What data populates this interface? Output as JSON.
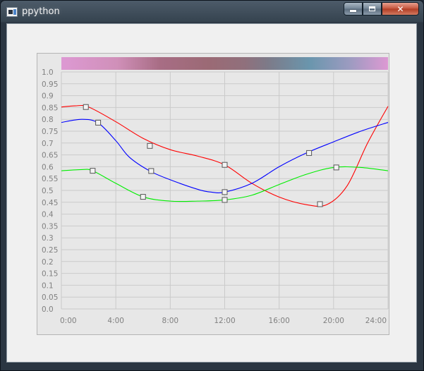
{
  "window": {
    "title": "ppython",
    "buttons": {
      "minimize": "minimize-icon",
      "maximize": "maximize-icon",
      "close": "close-icon"
    }
  },
  "chart_data": {
    "type": "line",
    "title": "",
    "xlabel": "",
    "ylabel": "",
    "x_ticks": [
      "0:00",
      "4:00",
      "8:00",
      "12:00",
      "16:00",
      "20:00",
      "24:00"
    ],
    "y_ticks": [
      "0.0",
      "0.05",
      "0.1",
      "0.15",
      "0.2",
      "0.25",
      "0.3",
      "0.35",
      "0.4",
      "0.45",
      "0.5",
      "0.55",
      "0.6",
      "0.65",
      "0.7",
      "0.75",
      "0.8",
      "0.85",
      "0.9",
      "0.95",
      "1.0"
    ],
    "xlim": [
      0,
      24
    ],
    "ylim": [
      0,
      1
    ],
    "grid": true,
    "series": [
      {
        "color": "#ff0000",
        "curve": [
          [
            0,
            0.852
          ],
          [
            1,
            0.857
          ],
          [
            2,
            0.852
          ],
          [
            4,
            0.79
          ],
          [
            6,
            0.72
          ],
          [
            8,
            0.672
          ],
          [
            10,
            0.645
          ],
          [
            12,
            0.608
          ],
          [
            14,
            0.53
          ],
          [
            16,
            0.472
          ],
          [
            18,
            0.44
          ],
          [
            19.5,
            0.44
          ],
          [
            21,
            0.52
          ],
          [
            22.5,
            0.7
          ],
          [
            24,
            0.855
          ]
        ],
        "points": [
          [
            1.8,
            0.852
          ],
          [
            6.5,
            0.688
          ],
          [
            12,
            0.608
          ],
          [
            19,
            0.442
          ]
        ]
      },
      {
        "color": "#0000ff",
        "curve": [
          [
            0,
            0.787
          ],
          [
            1.5,
            0.8
          ],
          [
            2.7,
            0.785
          ],
          [
            4,
            0.71
          ],
          [
            5,
            0.64
          ],
          [
            6.5,
            0.582
          ],
          [
            8,
            0.545
          ],
          [
            10,
            0.505
          ],
          [
            11,
            0.493
          ],
          [
            12,
            0.493
          ],
          [
            14,
            0.53
          ],
          [
            16,
            0.6
          ],
          [
            18,
            0.658
          ],
          [
            20,
            0.705
          ],
          [
            22,
            0.75
          ],
          [
            24,
            0.787
          ]
        ],
        "points": [
          [
            2.7,
            0.786
          ],
          [
            6.6,
            0.582
          ],
          [
            12,
            0.493
          ],
          [
            18.2,
            0.658
          ]
        ]
      },
      {
        "color": "#00ee00",
        "curve": [
          [
            0,
            0.583
          ],
          [
            1.5,
            0.588
          ],
          [
            2.3,
            0.583
          ],
          [
            4,
            0.53
          ],
          [
            6,
            0.473
          ],
          [
            8,
            0.455
          ],
          [
            10,
            0.455
          ],
          [
            12,
            0.46
          ],
          [
            14,
            0.48
          ],
          [
            16,
            0.525
          ],
          [
            18,
            0.568
          ],
          [
            20,
            0.597
          ],
          [
            22,
            0.597
          ],
          [
            24,
            0.583
          ]
        ],
        "points": [
          [
            2.3,
            0.583
          ],
          [
            6,
            0.473
          ],
          [
            12,
            0.46
          ],
          [
            20.2,
            0.597
          ]
        ]
      }
    ],
    "gradient_bar": {
      "stops": [
        {
          "pos": 0.0,
          "color": "#dd99d3"
        },
        {
          "pos": 0.17,
          "color": "#d090b9"
        },
        {
          "pos": 0.3,
          "color": "#a86d85"
        },
        {
          "pos": 0.45,
          "color": "#9b6a75"
        },
        {
          "pos": 0.56,
          "color": "#90707c"
        },
        {
          "pos": 0.63,
          "color": "#7d7a88"
        },
        {
          "pos": 0.76,
          "color": "#6a96ad"
        },
        {
          "pos": 0.88,
          "color": "#9b9bc0"
        },
        {
          "pos": 1.0,
          "color": "#dd99d3"
        }
      ]
    }
  }
}
